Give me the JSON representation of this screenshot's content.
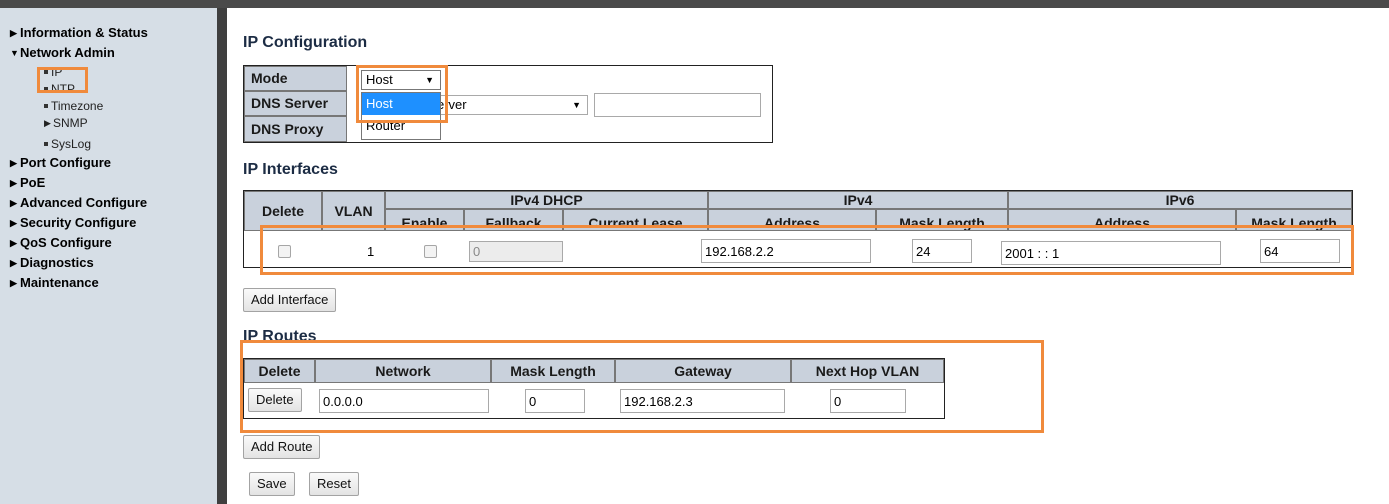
{
  "sidebar": {
    "items": [
      {
        "label": "Information & Status",
        "arrow": "▶"
      },
      {
        "label": "Network Admin",
        "arrow": "▼"
      }
    ],
    "sub_items": [
      {
        "label": "IP",
        "marker": "bullet"
      },
      {
        "label": "NTP",
        "marker": "bullet"
      },
      {
        "label": "Timezone",
        "marker": "bullet"
      },
      {
        "label": "SNMP",
        "marker": "arrow"
      },
      {
        "label": "SysLog",
        "marker": "bullet"
      }
    ],
    "more_items": [
      {
        "label": "Port Configure"
      },
      {
        "label": "PoE"
      },
      {
        "label": "Advanced Configure"
      },
      {
        "label": "Security Configure"
      },
      {
        "label": "QoS Configure"
      },
      {
        "label": "Diagnostics"
      },
      {
        "label": "Maintenance"
      }
    ]
  },
  "ip_config": {
    "title": "IP Configuration",
    "rows": {
      "mode": "Mode",
      "dns_server": "DNS Server",
      "dns_proxy": "DNS Proxy"
    },
    "mode_value": "Host",
    "dns_value_visible": "erver",
    "dropdown_options": [
      "Host",
      "Router"
    ]
  },
  "ip_interfaces": {
    "title": "IP Interfaces",
    "headers": {
      "delete": "Delete",
      "vlan": "VLAN",
      "ipv4_dhcp": "IPv4 DHCP",
      "ipv4": "IPv4",
      "ipv6": "IPv6",
      "enable": "Enable",
      "fallback": "Fallback",
      "current_lease": "Current Lease",
      "address": "Address",
      "mask_length": "Mask Length"
    },
    "row": {
      "vlan": "1",
      "fallback": "0",
      "ipv4_address": "192.168.2.2",
      "ipv4_mask": "24",
      "ipv6_address": "2001 : : 1",
      "ipv6_mask": "64"
    },
    "add_button": "Add Interface"
  },
  "ip_routes": {
    "title": "IP Routes",
    "headers": {
      "delete": "Delete",
      "network": "Network",
      "mask_length": "Mask Length",
      "gateway": "Gateway",
      "next_hop_vlan": "Next Hop VLAN"
    },
    "row": {
      "delete_button": "Delete",
      "network": "0.0.0.0",
      "mask_length": "0",
      "gateway": "192.168.2.3",
      "next_hop_vlan": "0"
    },
    "add_button": "Add Route"
  },
  "actions": {
    "save": "Save",
    "reset": "Reset"
  },
  "colors": {
    "highlight": "#f08a3c",
    "sidebar_bg": "#d6dee6",
    "header_bg": "#c9d1dc"
  }
}
